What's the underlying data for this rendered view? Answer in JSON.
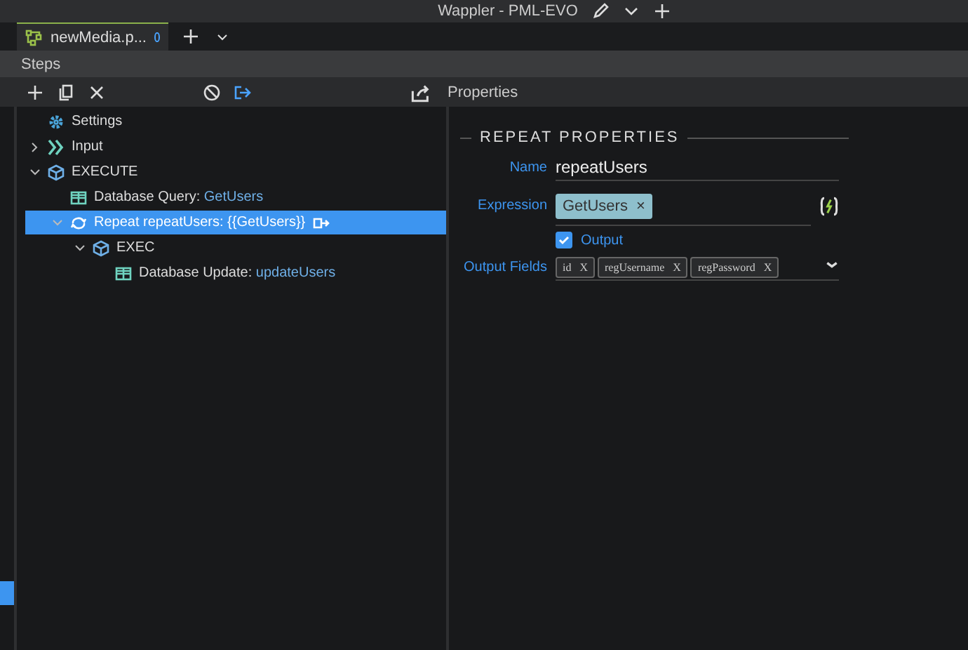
{
  "window": {
    "title": "Wappler - PML-EVO"
  },
  "tabs": [
    {
      "label": "newMedia.p...",
      "selected": true,
      "modified": true
    }
  ],
  "steps_panel": {
    "title": "Steps"
  },
  "tree": [
    {
      "kind": "settings",
      "label": "Settings",
      "selected": false
    },
    {
      "kind": "input",
      "label": "Input",
      "expanded": false,
      "selected": false
    },
    {
      "kind": "group",
      "label": "EXECUTE",
      "expanded": true,
      "selected": false,
      "children": [
        {
          "kind": "query",
          "label": "Database Query: ",
          "detail": "GetUsers",
          "selected": false
        },
        {
          "kind": "repeat",
          "label": "Repeat repeatUsers: {{GetUsers}}",
          "expanded": true,
          "selected": true,
          "children": [
            {
              "kind": "group",
              "label": "EXEC",
              "expanded": true,
              "selected": false,
              "children": [
                {
                  "kind": "query",
                  "label": "Database Update: ",
                  "detail": "updateUsers",
                  "selected": false
                }
              ]
            }
          ]
        }
      ]
    }
  ],
  "properties": {
    "title": "Properties",
    "section": "REPEAT PROPERTIES",
    "name_label": "Name",
    "name_value": "repeatUsers",
    "expression_label": "Expression",
    "expression_tag": "GetUsers",
    "expression_tag_close": "×",
    "output_label": "Output",
    "output_checked": true,
    "output_fields_label": "Output Fields",
    "output_fields": [
      {
        "label": "id",
        "close": "X"
      },
      {
        "label": "regUsername",
        "close": "X"
      },
      {
        "label": "regPassword",
        "close": "X"
      }
    ]
  }
}
